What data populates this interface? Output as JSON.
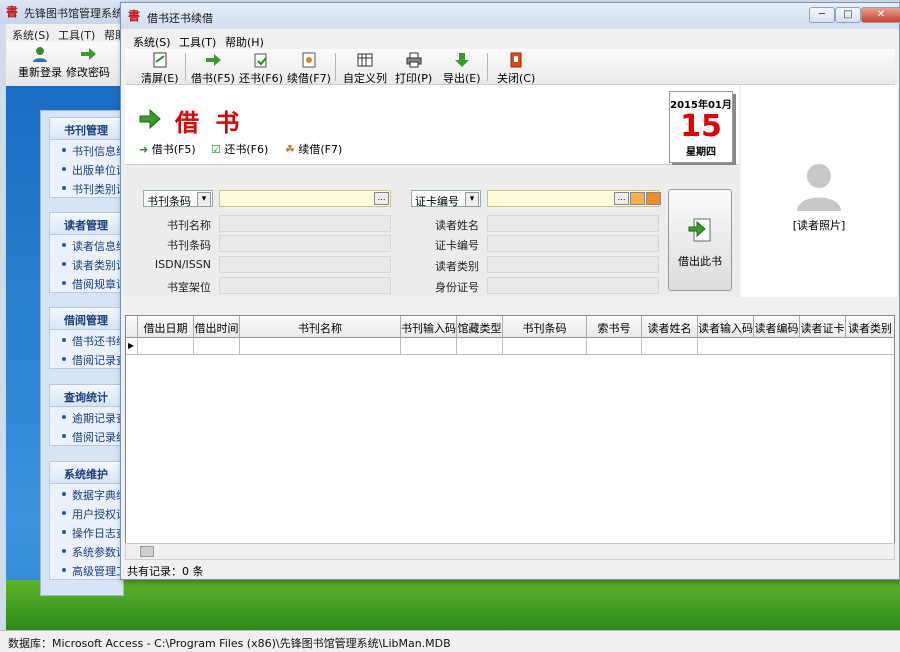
{
  "main_window": {
    "title": "先锋图书馆管理系统",
    "menu": [
      "系统(S)",
      "工具(T)",
      "帮助"
    ],
    "toolbar": [
      "重新登录",
      "修改密码"
    ]
  },
  "left_panel": {
    "groups": [
      {
        "title": "书刊管理",
        "items": [
          "书刊信息维护",
          "出版单位设置",
          "书刊类别设置"
        ]
      },
      {
        "title": "读者管理",
        "items": [
          "读者信息维护",
          "读者类别设置",
          "借阅规章设置"
        ]
      },
      {
        "title": "借阅管理",
        "items": [
          "借书还书续借",
          "借阅记录查询"
        ]
      },
      {
        "title": "查询统计",
        "items": [
          "逾期记录查询",
          "借阅记录统计"
        ]
      },
      {
        "title": "系统维护",
        "items": [
          "数据字典维护",
          "用户授权设置",
          "操作日志查询",
          "系统参数设置",
          "高级管理工具"
        ]
      }
    ]
  },
  "status_bar": "数据库：Microsoft Access - C:\\Program Files (x86)\\先锋图书馆管理系统\\LibMan.MDB",
  "child_window": {
    "title": "借书还书续借",
    "controls": {
      "minimize": "─",
      "maximize": "□",
      "close": "✕"
    },
    "menu": [
      "系统(S)",
      "工具(T)",
      "帮助(H)"
    ],
    "toolbar": [
      "清屏(E)",
      "借书(F5)",
      "还书(F6)",
      "续借(F7)",
      "自定义列",
      "打印(P)",
      "导出(E)",
      "关闭(C)"
    ],
    "mode_title": "借 书",
    "modes": [
      "借书(F5)",
      "还书(F6)",
      "续借(F7)"
    ],
    "calendar": {
      "year_month": "2015年01月",
      "day": "15",
      "weekday": "星期四"
    },
    "photo_label": "[读者照片]",
    "book": {
      "search_type": "书刊条码",
      "search_value": "",
      "fields": [
        "书刊名称",
        "书刊条码",
        "ISDN/ISSN",
        "书室架位"
      ]
    },
    "reader": {
      "search_type": "证卡编号",
      "search_value": "",
      "fields": [
        "读者姓名",
        "证卡编号",
        "读者类别",
        "身份证号"
      ]
    },
    "checkout_button": "借出此书",
    "grid_columns": [
      "借出日期",
      "借出时间",
      "书刊名称",
      "书刊输入码",
      "馆藏类型",
      "书刊条码",
      "索书号",
      "读者姓名",
      "读者输入码",
      "读者编码",
      "读者证卡",
      "读者类别"
    ],
    "record_count": "共有记录：0 条"
  }
}
